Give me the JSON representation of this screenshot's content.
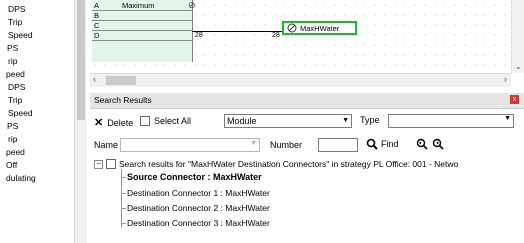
{
  "left_list": [
    "DPS",
    "Trip",
    "Speed",
    "PS",
    "rip",
    "peed",
    "DPS",
    "Trip",
    "Speed",
    "PS",
    "rip",
    "peed",
    "Off",
    "dulating"
  ],
  "block": {
    "pins": [
      "A",
      "B",
      "C",
      "D"
    ],
    "pin_a_label": "Maximum",
    "wire_number_left": "28",
    "wire_number_right": "28"
  },
  "connector_tag": {
    "label": "MaxHWater"
  },
  "panel": {
    "title": "Search Results",
    "close_icon": "close-icon",
    "delete_label": "Delete",
    "select_all_label": "Select All",
    "module_value": "Module",
    "type_label": "Type",
    "type_value": "",
    "name_label": "Name",
    "name_value": "",
    "number_label": "Number",
    "number_value": "",
    "find_label": "Find"
  },
  "results": {
    "root": "Search results for \"MaxHWater Destination Connectors\" in strategy PL Office: 001 - Netwo",
    "source": "Source Connector : MaxHWater",
    "destinations": [
      "Destination Connector 1 : MaxHWater",
      "Destination Connector 2 : MaxHWater",
      "Destination Connector 3 : MaxHWater"
    ]
  },
  "colors": {
    "block_fill": "#e2f6e7",
    "tag_border": "#1fba2a",
    "close_button": "#d83434"
  }
}
